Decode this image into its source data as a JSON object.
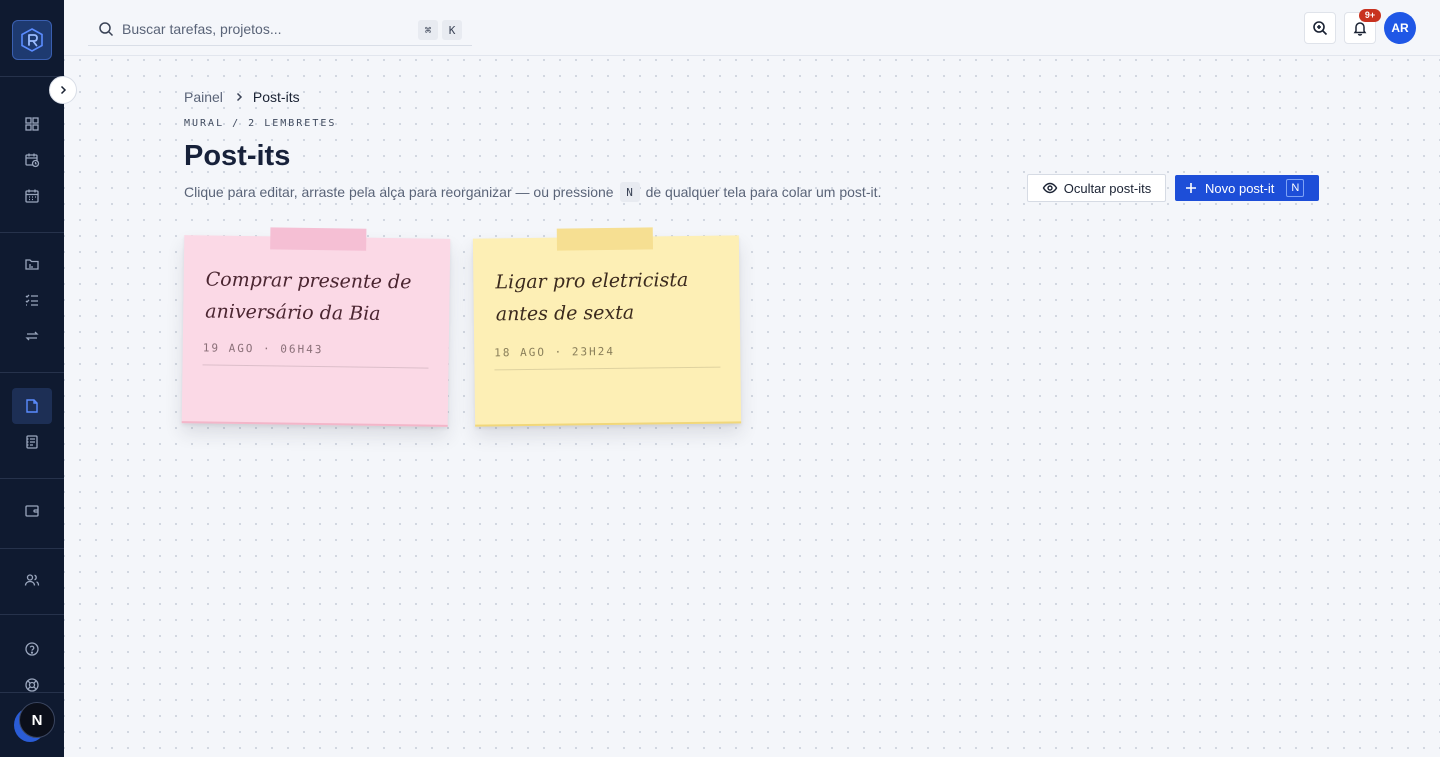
{
  "topbar": {
    "search_placeholder": "Buscar tarefas, projetos...",
    "search_kbd_1": "⌘",
    "search_kbd_2": "K",
    "notifications_badge": "9+",
    "avatar_initials": "AR"
  },
  "sidebar": {
    "items": [
      {
        "name": "dashboard-icon"
      },
      {
        "name": "calendar-clock-icon"
      },
      {
        "name": "calendar-icon"
      },
      {
        "name": "folder-icon"
      },
      {
        "name": "checklist-icon"
      },
      {
        "name": "repeat-icon"
      },
      {
        "name": "sticky-note-icon",
        "active": true
      },
      {
        "name": "notebook-icon"
      },
      {
        "name": "wallet-icon"
      },
      {
        "name": "users-icon"
      },
      {
        "name": "help-icon"
      },
      {
        "name": "support-icon"
      }
    ],
    "bottom_badge": "N"
  },
  "breadcrumb": {
    "parent": "Painel",
    "current": "Post-its"
  },
  "page": {
    "eyebrow": "MURAL / 2 LEMBRETES",
    "title": "Post-its",
    "subtitle_before": "Clique para editar, arraste pela alça para reorganizar — ou pressione",
    "subtitle_key": "N",
    "subtitle_after": "de qualquer tela para colar um post-it."
  },
  "actions": {
    "hide_label": "Ocultar post-its",
    "new_label": "Novo post-it",
    "new_shortcut": "N"
  },
  "notes": [
    {
      "text": "Comprar presente de aniversário da Bia",
      "date": "19 AGO · 06H43",
      "color": "#fbd9e6"
    },
    {
      "text": "Ligar pro eletricista antes de sexta",
      "date": "18 AGO · 23H24",
      "color": "#fdefb5"
    }
  ],
  "colors": {
    "sidebar_bg": "#0f1a30",
    "accent": "#1d4ed8",
    "notification": "#c8321f"
  }
}
